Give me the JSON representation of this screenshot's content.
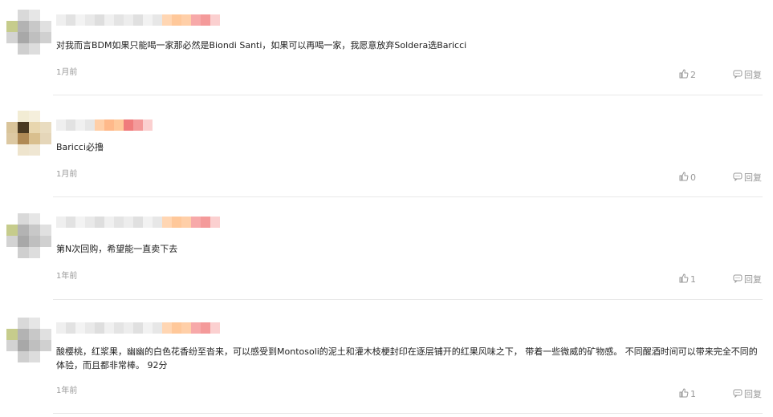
{
  "colors": {
    "text": "#222222",
    "meta": "#999999",
    "divider": "#e8e8e8"
  },
  "comments": [
    {
      "text": "对我而言BDM如果只能喝一家那必然是Biondi Santi，如果可以再喝一家，我愿意放弃Soldera选Baricci",
      "time": "1月前",
      "likes": "2",
      "reply_label": "回复"
    },
    {
      "text": "Baricci必撸",
      "time": "1月前",
      "likes": "0",
      "reply_label": "回复"
    },
    {
      "text": "第N次回购，希望能一直卖下去",
      "time": "1年前",
      "likes": "1",
      "reply_label": "回复"
    },
    {
      "text": "酸樱桃，红浆果，幽幽的白色花香纷至沓来，可以感受到Montosoli的泥土和灌木枝梗封印在逐层铺开的红果风味之下， 带着一些微威的矿物感。 不同醒酒时间可以带来完全不同的体验，而且都非常棒。 92分",
      "time": "1年前",
      "likes": "1",
      "reply_label": "回复"
    }
  ],
  "icons": {
    "like": "thumbs-up-icon",
    "reply": "comment-icon"
  }
}
